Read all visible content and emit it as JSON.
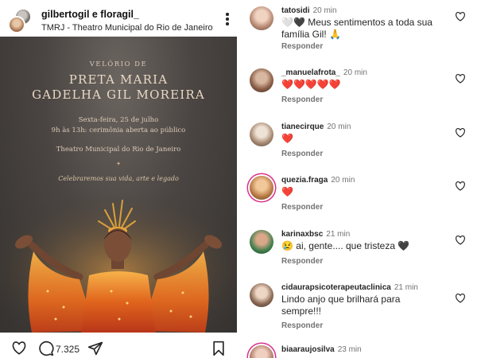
{
  "post": {
    "username": "gilbertogil e floragil_",
    "location": "TMRJ - Theatro Municipal do Rio de Janeiro",
    "invite": {
      "kicker": "VELÓRIO DE",
      "name_line1": "PRETA MARIA",
      "name_line2": "GADELHA GIL MOREIRA",
      "date": "Sexta-feira, 25 de julho",
      "time": "9h às 13h: cerimônia aberta ao público",
      "venue": "Theatro Municipal do Rio de Janeiro",
      "separator": "✦",
      "tagline": "Celebraremos sua vida, arte e legado"
    },
    "actions": {
      "like_icon": "heart-outline",
      "comment_icon": "comment-bubble",
      "comment_count": "7.325",
      "share_icon": "paper-plane",
      "save_icon": "bookmark"
    }
  },
  "comments": [
    {
      "user": "tatosidi",
      "time": "20 min",
      "text": "🤍🖤 Meus sentimentos a toda sua família Gil! 🙏",
      "reply": "Responder"
    },
    {
      "user": "_manuelafrota_",
      "time": "20 min",
      "text": "❤️❤️❤️❤️❤️",
      "reply": "Responder"
    },
    {
      "user": "tianecirque",
      "time": "20 min",
      "text": "❤️",
      "reply": "Responder"
    },
    {
      "user": "quezia.fraga",
      "time": "20 min",
      "text": "❤️",
      "reply": "Responder"
    },
    {
      "user": "karinaxbsc",
      "time": "21 min",
      "text": "😢 ai, gente.... que tristeza 🖤",
      "reply": "Responder"
    },
    {
      "user": "cidaurapsicoterapeutaclinica",
      "time": "21 min",
      "text": "Lindo anjo que brilhará para sempre!!!",
      "reply": "Responder"
    },
    {
      "user": "biaaraujosilva",
      "time": "23 min",
      "text": "",
      "reply": ""
    }
  ],
  "colors": {
    "like_red": "#e8312f",
    "story_ring": "#d9318a",
    "secondary_text": "#737373"
  }
}
